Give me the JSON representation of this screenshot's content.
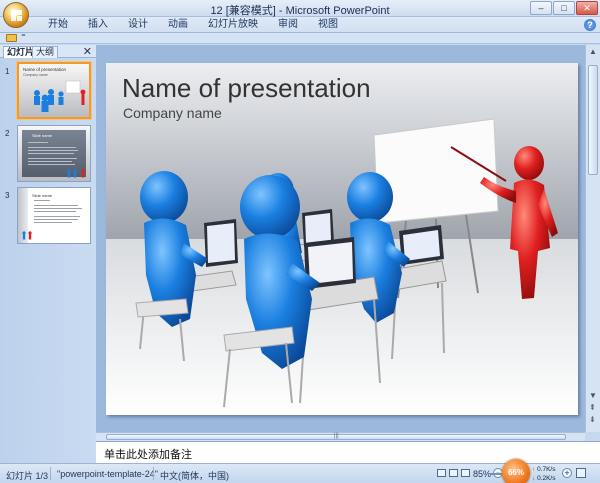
{
  "window": {
    "title": "12 [兼容模式] - Microsoft PowerPoint"
  },
  "window_controls": {
    "minimize": "–",
    "maximize": "□",
    "close": "✕"
  },
  "ribbon": {
    "tabs": [
      "开始",
      "插入",
      "设计",
      "动画",
      "幻灯片放映",
      "审阅",
      "视图"
    ],
    "help": "?"
  },
  "qat": {
    "more": "⁼"
  },
  "left_pane": {
    "tabs": [
      "幻灯片",
      "大纲"
    ],
    "close": "✕",
    "slides": [
      {
        "num": "1",
        "title": "Name of presentation",
        "sub": "Company name"
      },
      {
        "num": "2",
        "title": "Slide name"
      },
      {
        "num": "3",
        "title": "Slide name"
      }
    ]
  },
  "slide": {
    "title": "Name of presentation",
    "subtitle": "Company name"
  },
  "notes": {
    "placeholder": "单击此处添加备注"
  },
  "status": {
    "slide_counter": "幻灯片 1/3",
    "template": "\"powerpoint-template-24\"",
    "language": "中文(简体，中国)",
    "zoom": "85%",
    "badge": "66%",
    "net_up": "0.7K/s",
    "net_down": "0.2K/s"
  },
  "colors": {
    "figure_blue": "#1a7fe0",
    "presenter_red": "#e02020",
    "selection": "#f29b2a"
  }
}
